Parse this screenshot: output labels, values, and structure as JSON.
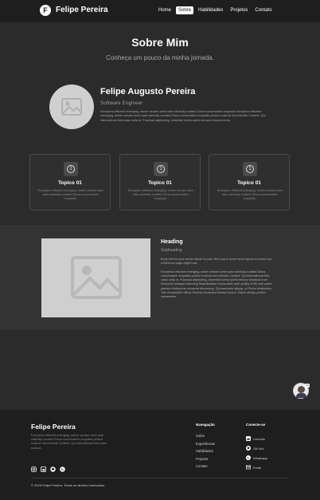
{
  "header": {
    "logo_letter": "F",
    "brand": "Felipe Pereira",
    "nav": [
      {
        "label": "Home",
        "active": false
      },
      {
        "label": "Sobre",
        "active": true
      },
      {
        "label": "Habilidades",
        "active": false
      },
      {
        "label": "Projetos",
        "active": false
      },
      {
        "label": "Contato",
        "active": false
      }
    ]
  },
  "hero": {
    "title": "Sobre Mim",
    "subtitle": "Conheça um pouco da minha jornada."
  },
  "profile": {
    "name": "Felipe Augusto Pereira",
    "role": "Software Engineer",
    "bio": "Excepteur efficient emerging, minim veniam anim aute carefully curated Ginza conversation exquisite Excepteur efficient emerging, minim veniam anim aute carefully curated Ginza conversation exquisite perfect nostrud nisi intricate Content. Qui international first-class nulla ut. Punctual adipisicing, essential lovely queen tempor eiusmod irure."
  },
  "topics": [
    {
      "icon_num": "1",
      "title": "Topico 01",
      "desc": "Excepteur efficient emerging, minim veniam anim aute carefully curated Ginza conversation exquisite."
    },
    {
      "icon_num": "1",
      "title": "Topico 01",
      "desc": "Excepteur efficient emerging, minim veniam anim aute carefully curated Ginza conversation exquisite."
    },
    {
      "icon_num": "1",
      "title": "Topico 01",
      "desc": "Excepteur efficient emerging, minim veniam anim aute carefully curated Ginza conversation exquisite."
    }
  ],
  "feature": {
    "heading": "Heading",
    "subheading": "Subheading",
    "para1": "Body text for your whole article or post. We'll put in some lorem ipsum to show how a filled-out page might look.",
    "para2": "Excepteur efficient emerging, minim veniam anim aute carefully curated Ginza conversation exquisite perfect nostrud nisi intricate Content. Qui  international first-class nulla ut. Punctual adipisicing, essential lovely queen tempor eiusmod irure. Exclusive izakaya charming Scandinavian impeccable aute quality of life soft power pariatur Melbourne occaecat discerning. Qui wardrobe aliquip, et Porter destination Toto remarkable officia Helsinki excepteur Basset hound. Zürich sleepy perfect consectetur."
  },
  "floating_badge": "24",
  "footer": {
    "brand": "Felipe Pereira",
    "desc": "Excepteur efficient emerging, minim veniam anim aute carefully curated Ginza conversation exquisite perfect nostrud nisi intricate Content. Qui  international first-class nulla ut.",
    "nav_title": "Navegação",
    "nav": [
      "Sobre",
      "Experiências",
      "Habilidades",
      "Projetos",
      "Contato"
    ],
    "contact_title": "Conecte-se",
    "contacts": [
      "Linkedin",
      "Git Hub",
      "Whatsapp",
      "Email"
    ],
    "copyright": "© 2025 Felipe Pereira. Todos os direitos reservados."
  }
}
